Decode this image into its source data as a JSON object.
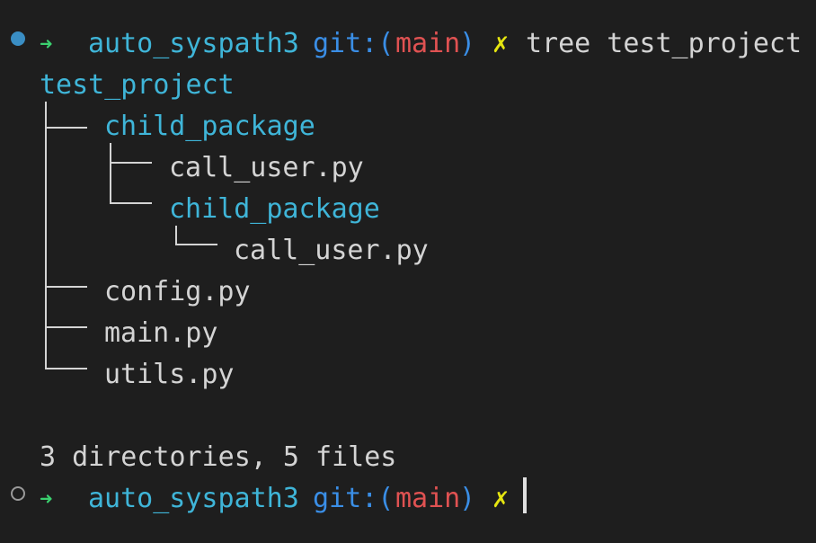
{
  "prompt1": {
    "arrow": "➜",
    "cwd": "auto_syspath3",
    "git_prefix": "git:(",
    "branch": "main",
    "git_suffix": ")",
    "dirty": "✗",
    "command": "tree test_project"
  },
  "tree": {
    "root": "test_project",
    "entries": [
      {
        "name": "child_package",
        "type": "directory"
      },
      {
        "name": "call_user.py",
        "type": "file"
      },
      {
        "name": "child_package",
        "type": "directory"
      },
      {
        "name": "call_user.py",
        "type": "file"
      },
      {
        "name": "config.py",
        "type": "file"
      },
      {
        "name": "main.py",
        "type": "file"
      },
      {
        "name": "utils.py",
        "type": "file"
      }
    ]
  },
  "summary": "3 directories, 5 files",
  "prompt2": {
    "arrow": "➜",
    "cwd": "auto_syspath3",
    "git_prefix": "git:(",
    "branch": "main",
    "git_suffix": ")",
    "dirty": "✗"
  },
  "colors": {
    "background": "#1e1e1e",
    "directory": "#3fb5d8",
    "file": "#d4d4d4",
    "arrow": "#3bd16f",
    "git": "#3a8ee6",
    "branch": "#e05252",
    "dirty": "#e5e510",
    "status_dot_active": "#3a8ec4"
  }
}
